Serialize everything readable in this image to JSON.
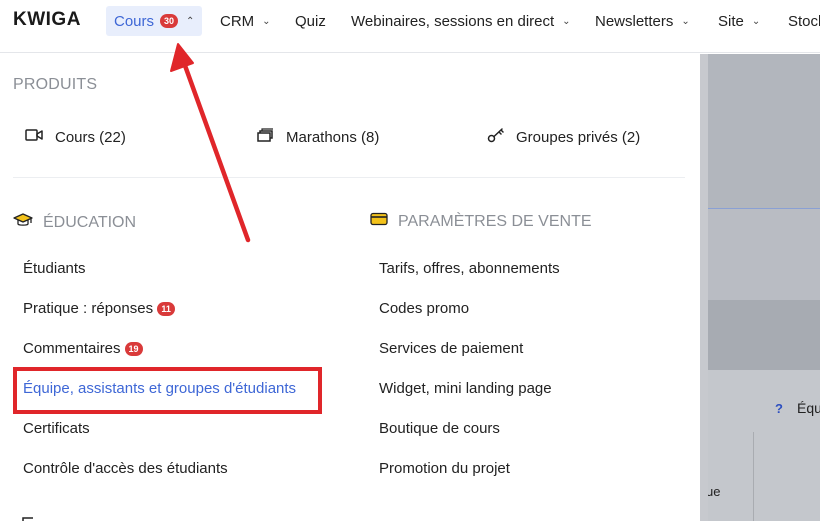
{
  "logo": "KWIGA",
  "nav": {
    "cours": {
      "label": "Cours",
      "badge": "30"
    },
    "crm": "CRM",
    "quiz": "Quiz",
    "webinaires": "Webinaires, sessions en direct",
    "newsletters": "Newsletters",
    "site": "Site",
    "stock": "Stock"
  },
  "produits": {
    "title": "PRODUITS",
    "items": [
      {
        "label": "Cours (22)",
        "icon": "video-icon"
      },
      {
        "label": "Marathons (8)",
        "icon": "stack-icon"
      },
      {
        "label": "Groupes privés (2)",
        "icon": "key-icon"
      }
    ]
  },
  "education": {
    "title": "ÉDUCATION",
    "icon": "graduation-cap-icon",
    "items": [
      {
        "label": "Étudiants"
      },
      {
        "label": "Pratique : réponses",
        "badge": "11"
      },
      {
        "label": "Commentaires",
        "badge": "19"
      },
      {
        "label": "Équipe, assistants et groupes d'étudiants"
      },
      {
        "label": "Certificats"
      },
      {
        "label": "Contrôle d'accès des étudiants"
      }
    ]
  },
  "vente": {
    "title": "PARAMÈTRES DE VENTE",
    "icon": "credit-card-icon",
    "items": [
      {
        "label": "Tarifs, offres, abonnements"
      },
      {
        "label": "Codes promo"
      },
      {
        "label": "Services de paiement"
      },
      {
        "label": "Widget, mini landing page"
      },
      {
        "label": "Boutique de cours"
      },
      {
        "label": "Promotion du projet"
      }
    ]
  },
  "background": {
    "help_mark": "?",
    "equ_text": "Équ",
    "ue_text": "ue"
  },
  "colors": {
    "accent": "#3e67d6",
    "badge": "#d93a3a",
    "highlight_box": "#e0262a",
    "arrow": "#e0262a"
  }
}
